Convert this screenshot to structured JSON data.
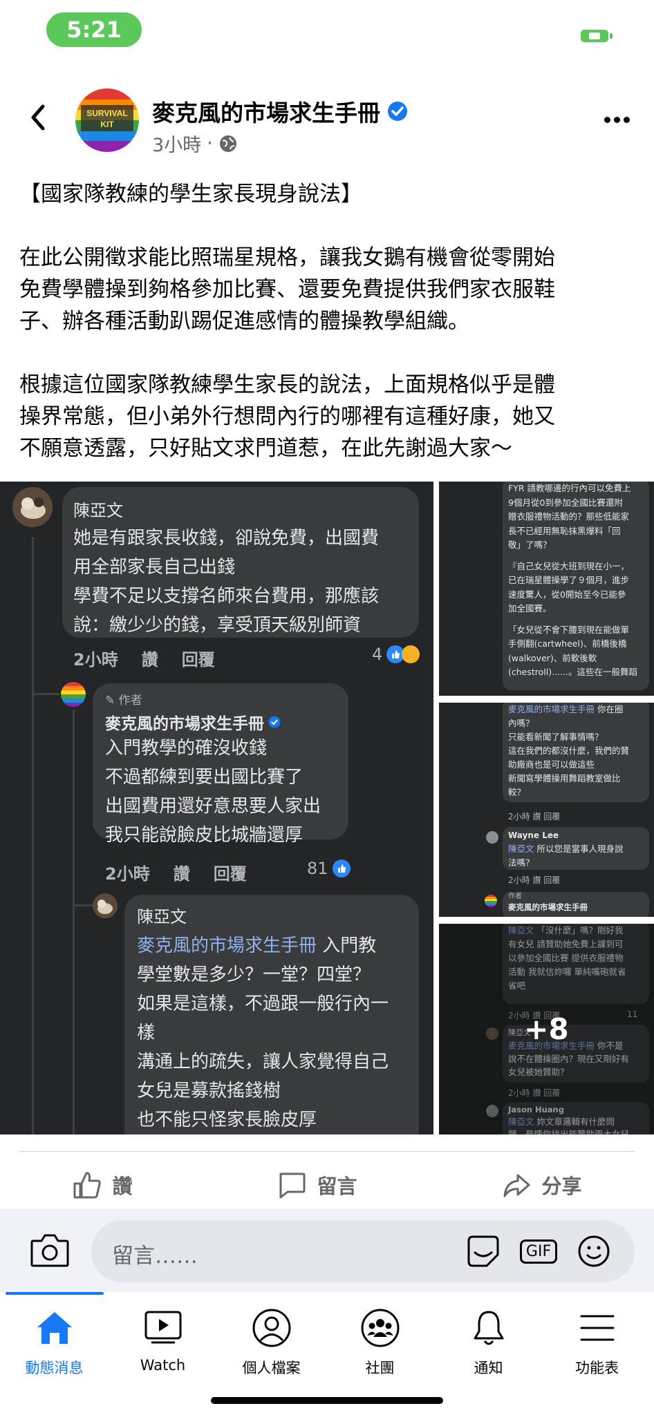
{
  "status_bar": {
    "time": "5:21"
  },
  "header": {
    "page_name": "麥克風的市場求生手冊",
    "time_ago": "3小時",
    "separator": "·",
    "avatar_text_top": "SURVIVAL",
    "avatar_text_bottom": "KIT"
  },
  "post": {
    "title": "【國家隊教練的學生家長現身說法】",
    "para1_lines": [
      "在此公開徵求能比照瑞星規格，讓我女鵝有機會從零開始",
      "免費學體操到夠格參加比賽、還要免費提供我們家衣服鞋",
      "子、辦各種活動趴踢促進感情的體操教學組織。"
    ],
    "para2_lines": [
      "根據這位國家隊教練學生家長的說法，上面規格似乎是體",
      "操界常態，但小弟外行想問內行的哪裡有這種好康，她又",
      "不願意透露，只好貼文求門道惹，在此先謝過大家～"
    ]
  },
  "image_main": {
    "c1": {
      "name": "陳亞文",
      "lines": [
        "她是有跟家長收錢，卻說免費，出國費",
        "用全部家長自己出錢",
        "學費不足以支撐名師來台費用，那應該",
        "說：繳少少的錢，享受頂天級別師資"
      ],
      "time": "2小時",
      "like": "讚",
      "reply": "回覆",
      "count": "4"
    },
    "c2": {
      "author_tag": "作者",
      "name": "麥克風的市場求生手冊",
      "lines": [
        "入門教學的確沒收錢",
        "不過都練到要出國比賽了",
        "出國費用還好意思要人家出",
        "我只能說臉皮比城牆還厚"
      ],
      "time": "2小時",
      "like": "讚",
      "reply": "回覆",
      "count": "81"
    },
    "c3": {
      "name": "陳亞文",
      "mention": "麥克風的市場求生手冊",
      "first_rest": " 入門教",
      "lines": [
        "學堂數是多少？一堂？四堂？",
        "如果是這樣，不過跟一般行內一",
        "樣",
        "溝通上的疏失，讓人家覺得自己",
        "女兒是募款搖錢樹",
        "也不能只怪家長臉皮厚"
      ]
    }
  },
  "image_side1": {
    "lines": [
      "FYR 請教哪邊的行內可以免費上",
      "9個月從0到參加全國比賽還附",
      "贈衣服禮物活動的？那些低能家",
      "長不已經用無恥抹黑爆料「回",
      "敬」了嗎？",
      "",
      "『自己女兒從大班到現在小一，",
      "已在瑞星體操學了９個月，進步",
      "速度驚人，從0開始至今已能參",
      "加全國賽。",
      "",
      "「女兒從不會下腰到現在能做單",
      "手側翻(cartwheel)、前橋後橋",
      "(walkover)、前軟後軟",
      "(chestroll)......。這些在一般舞蹈"
    ]
  },
  "image_side2": {
    "mention1": "麥克風的市場求生手冊",
    "rest1": " 你在圈",
    "lines": [
      "內嗎？",
      "只能看新聞了解事情嗎？",
      "這在我們的都沒什麼，我們的贊",
      "助廠商也是可以做這些",
      "新聞寫學體操用舞蹈教室做比",
      "較？"
    ],
    "meta1": "2小時   讚   回覆",
    "name2": "Wayne Lee",
    "mention2": "陳亞文",
    "rest2": " 所以您是當事人現身說",
    "line2b": "法嗎？",
    "meta2": "2小時   讚   回覆",
    "author_tag": "作者",
    "name3": "麥克風的市場求生手冊"
  },
  "image_side3": {
    "mention1": "陳亞文",
    "rest1": " 「沒什麼」嗎？剛好我",
    "lines": [
      "有女兒 請贊助她免費上課到可",
      "以參加全國比賽 提供衣服禮物",
      "活動 我就信妳囉 單純嘴砲就省",
      "省吧"
    ],
    "meta1": "2小時   讚   回覆",
    "count1": "11",
    "name2": "陳亞文",
    "mention2": "麥克風的市場求生手冊",
    "rest2": " 你不是",
    "lines2": [
      "說不在體操圈內？現在又剛好有",
      "女兒被她贊助？"
    ],
    "meta2": "2小時   讚   回覆",
    "name3": "Jason Huang",
    "mention3": "陳亞文",
    "rest3": " 妳文章邏輯有什麼問",
    "line3b": "題，最情你找出能贊助兩大女兒",
    "more_count": "+8"
  },
  "actions": {
    "like": "讚",
    "comment": "留言",
    "share": "分享"
  },
  "composer": {
    "placeholder": "留言……",
    "gif": "GIF"
  },
  "tabs": [
    {
      "label": "動態消息",
      "icon": "home-icon"
    },
    {
      "label": "Watch",
      "icon": "watch-icon"
    },
    {
      "label": "個人檔案",
      "icon": "profile-icon"
    },
    {
      "label": "社團",
      "icon": "groups-icon"
    },
    {
      "label": "通知",
      "icon": "bell-icon"
    },
    {
      "label": "功能表",
      "icon": "menu-icon"
    }
  ],
  "colors": {
    "accent": "#1877f2",
    "status_green": "#5ac85a",
    "dark_bg": "#242526",
    "bubble": "#3a3b3c"
  }
}
